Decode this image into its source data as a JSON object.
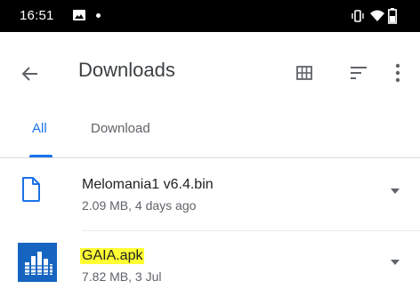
{
  "status_bar": {
    "time": "16:51",
    "icons": [
      "image-icon",
      "dot-icon",
      "vibrate-icon",
      "wifi-icon",
      "battery-icon"
    ]
  },
  "toolbar": {
    "title": "Downloads",
    "icons": [
      "back-arrow-icon",
      "grid-view-icon",
      "sort-icon",
      "more-vert-icon"
    ]
  },
  "tabs": [
    {
      "label": "All",
      "selected": true
    },
    {
      "label": "Download",
      "selected": false
    }
  ],
  "files": [
    {
      "name": "Melomania1 v6.4.bin",
      "meta": "2.09 MB, 4 days ago",
      "icon": "file-icon",
      "highlighted": false
    },
    {
      "name": "GAIA.apk",
      "meta": "7.82 MB, 3 Jul",
      "icon": "apk-app-icon",
      "highlighted": true
    }
  ],
  "colors": {
    "accent": "#1a73e8",
    "highlight": "#ffff33",
    "file_icon": "#1a73e8",
    "apk_icon_bg": "#1565c0"
  }
}
